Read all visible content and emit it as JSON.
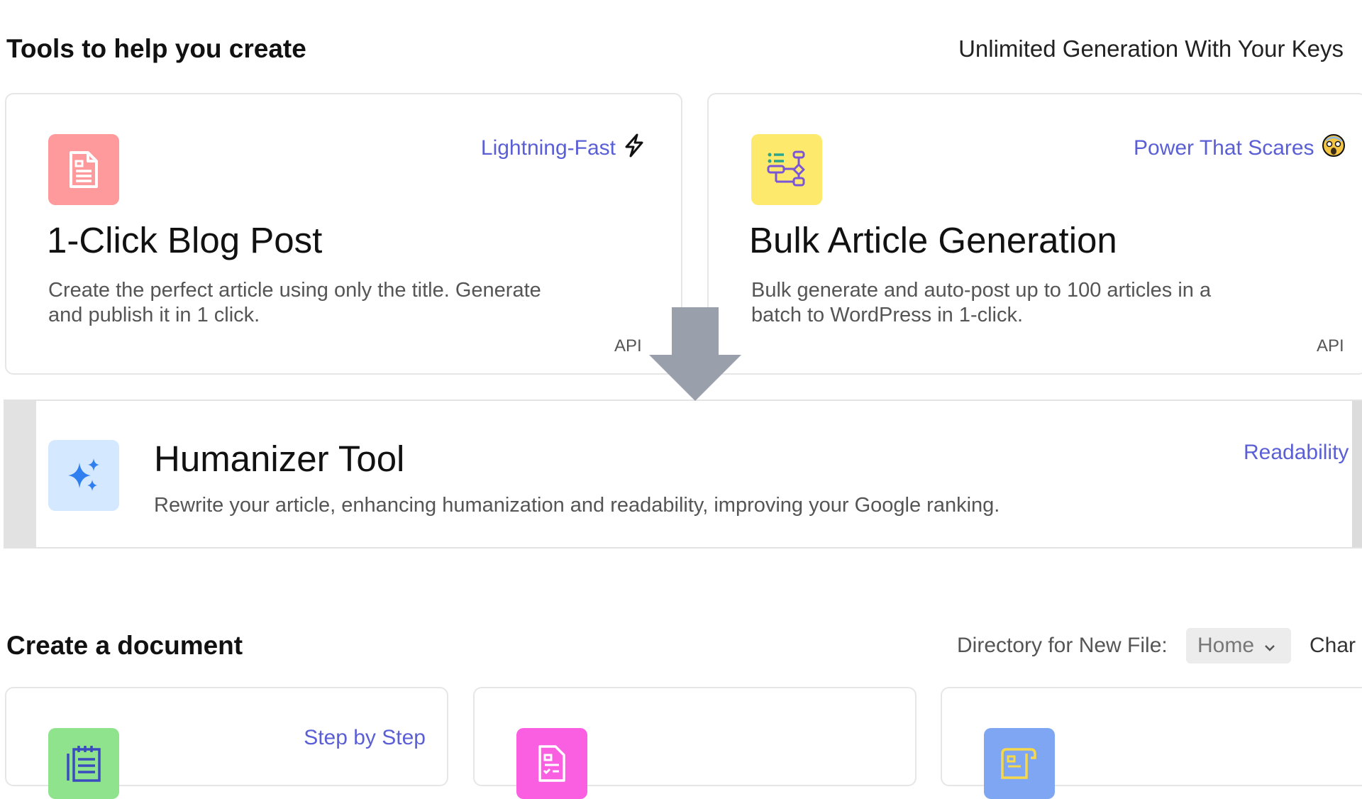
{
  "tools_section": {
    "title": "Tools to help you create",
    "right_link": "Unlimited Generation With Your Keys"
  },
  "cards": {
    "blog_post": {
      "tag": "Lightning-Fast",
      "title": "1-Click Blog Post",
      "desc_line1": "Create the perfect article using only the title. Generate",
      "desc_line2": "and publish it in 1 click.",
      "api": "API",
      "icon": "document-icon",
      "icon_bg": "#fe9a9c"
    },
    "bulk": {
      "tag": "Power That Scares",
      "title": "Bulk Article Generation",
      "desc_line1": "Bulk generate and auto-post up to 100 articles in a",
      "desc_line2": "batch to WordPress in 1-click.",
      "api": "API",
      "icon": "workflow-icon",
      "icon_bg": "#fde96c"
    },
    "humanizer": {
      "tag": "Readability",
      "title": "Humanizer Tool",
      "desc": "Rewrite your article, enhancing humanization and readability, improving your Google ranking.",
      "icon": "sparkles-icon",
      "icon_bg": "#d4e8ff"
    }
  },
  "document_section": {
    "title": "Create a document",
    "directory_label": "Directory for New File:",
    "directory_value": "Home",
    "trailing_label": "Char"
  },
  "doc_cards": [
    {
      "tag": "Step by Step",
      "icon": "notepad-icon",
      "icon_bg": "#8fe38c"
    },
    {
      "tag": "",
      "icon": "checklist-document-icon",
      "icon_bg": "#f95fe0"
    },
    {
      "tag": "",
      "icon": "scroll-icon",
      "icon_bg": "#7ea6f2"
    }
  ],
  "colors": {
    "accent": "#5b5fd6",
    "arrow": "#9aa0ab"
  }
}
